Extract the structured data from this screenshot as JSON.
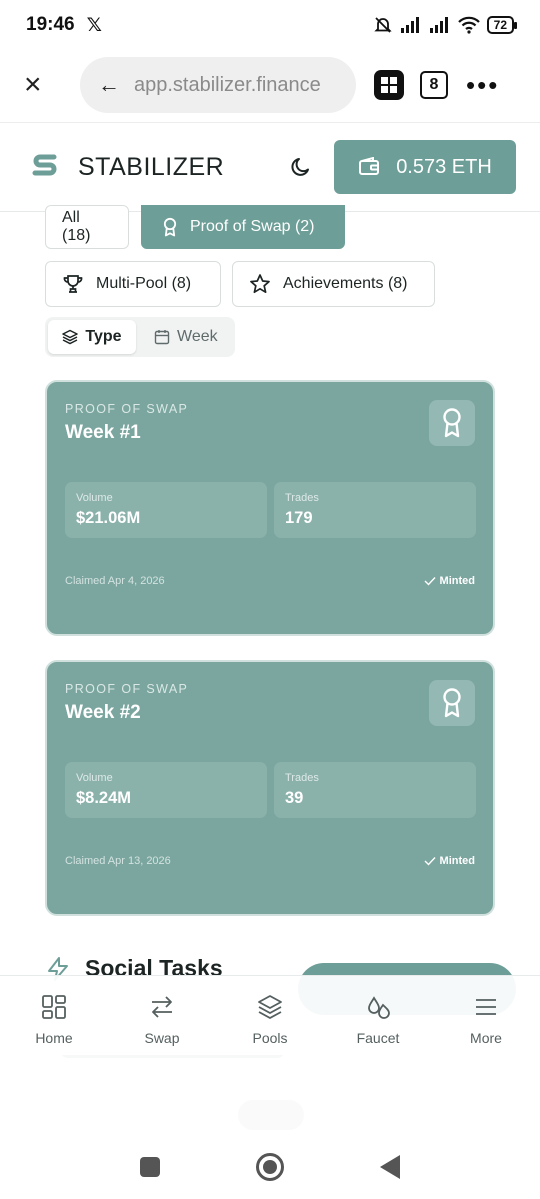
{
  "status_bar": {
    "time": "19:46",
    "x_icon": "x-logo-icon",
    "battery": "72"
  },
  "browser": {
    "url": "app.stabilizer.finance",
    "tab_count": "8"
  },
  "header": {
    "brand": "STABILIZER",
    "wallet_balance": "0.573 ETH"
  },
  "filters": {
    "all": "All (18)",
    "proof_of_swap": "Proof of Swap (2)",
    "multi_pool": "Multi-Pool (8)",
    "achievements": "Achievements (8)"
  },
  "view_toggle": {
    "type": "Type",
    "week": "Week"
  },
  "cards": [
    {
      "kicker": "PROOF OF SWAP",
      "title": "Week #1",
      "volume_label": "Volume",
      "volume": "$21.06M",
      "trades_label": "Trades",
      "trades": "179",
      "claimed": "Claimed Apr 4, 2026",
      "status": "Minted"
    },
    {
      "kicker": "PROOF OF SWAP",
      "title": "Week #2",
      "volume_label": "Volume",
      "volume": "$8.24M",
      "trades_label": "Trades",
      "trades": "39",
      "claimed": "Claimed Apr 13, 2026",
      "status": "Minted"
    }
  ],
  "social": {
    "heading": "Social Tasks"
  },
  "bottom_nav": [
    {
      "label": "Home",
      "icon": "grid-icon"
    },
    {
      "label": "Swap",
      "icon": "swap-arrows-icon"
    },
    {
      "label": "Pools",
      "icon": "layers-icon"
    },
    {
      "label": "Faucet",
      "icon": "droplets-icon"
    },
    {
      "label": "More",
      "icon": "menu-icon"
    }
  ],
  "colors": {
    "accent": "#6d9e97",
    "card": "#7ba59f",
    "card_inner": "#8bb1ab"
  }
}
